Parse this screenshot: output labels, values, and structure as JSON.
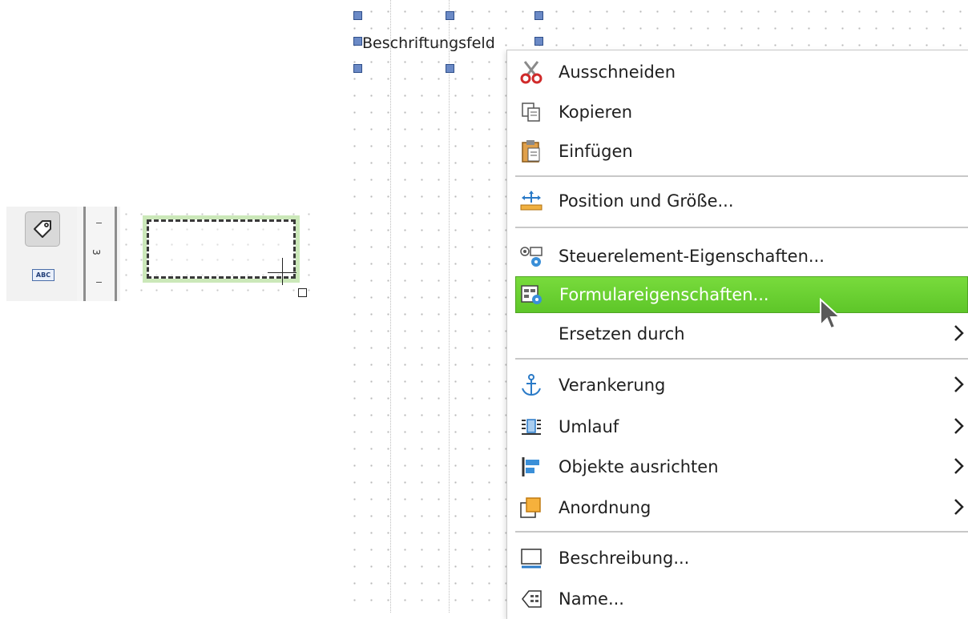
{
  "canvas": {
    "label_field_text": "Beschriftungsfeld"
  },
  "inset": {
    "ruler_number": "3",
    "abc_icon_text": "ABC"
  },
  "context_menu": {
    "items": [
      {
        "label": "Ausschneiden",
        "icon": "scissors-icon",
        "submenu": false
      },
      {
        "label": "Kopieren",
        "icon": "copy-icon",
        "submenu": false
      },
      {
        "label": "Einfügen",
        "icon": "paste-icon",
        "submenu": false
      },
      {
        "label": "Position und Größe...",
        "icon": "position-size-icon",
        "submenu": false
      },
      {
        "label": "Steuerelement-Eigenschaften...",
        "icon": "control-properties-icon",
        "submenu": false
      },
      {
        "label": "Formulareigenschaften...",
        "icon": "form-properties-icon",
        "submenu": false,
        "highlighted": true
      },
      {
        "label": "Ersetzen durch",
        "icon": "",
        "submenu": true
      },
      {
        "label": "Verankerung",
        "icon": "anchor-icon",
        "submenu": true
      },
      {
        "label": "Umlauf",
        "icon": "wrap-icon",
        "submenu": true
      },
      {
        "label": "Objekte ausrichten",
        "icon": "align-objects-icon",
        "submenu": true
      },
      {
        "label": "Anordnung",
        "icon": "arrange-icon",
        "submenu": true
      },
      {
        "label": "Beschreibung...",
        "icon": "description-icon",
        "submenu": false
      },
      {
        "label": "Name...",
        "icon": "name-icon",
        "submenu": false
      }
    ]
  },
  "colors": {
    "highlight": "#66cc33",
    "handle": "#6b8ac6",
    "selection_glow": "#8ccd64"
  }
}
